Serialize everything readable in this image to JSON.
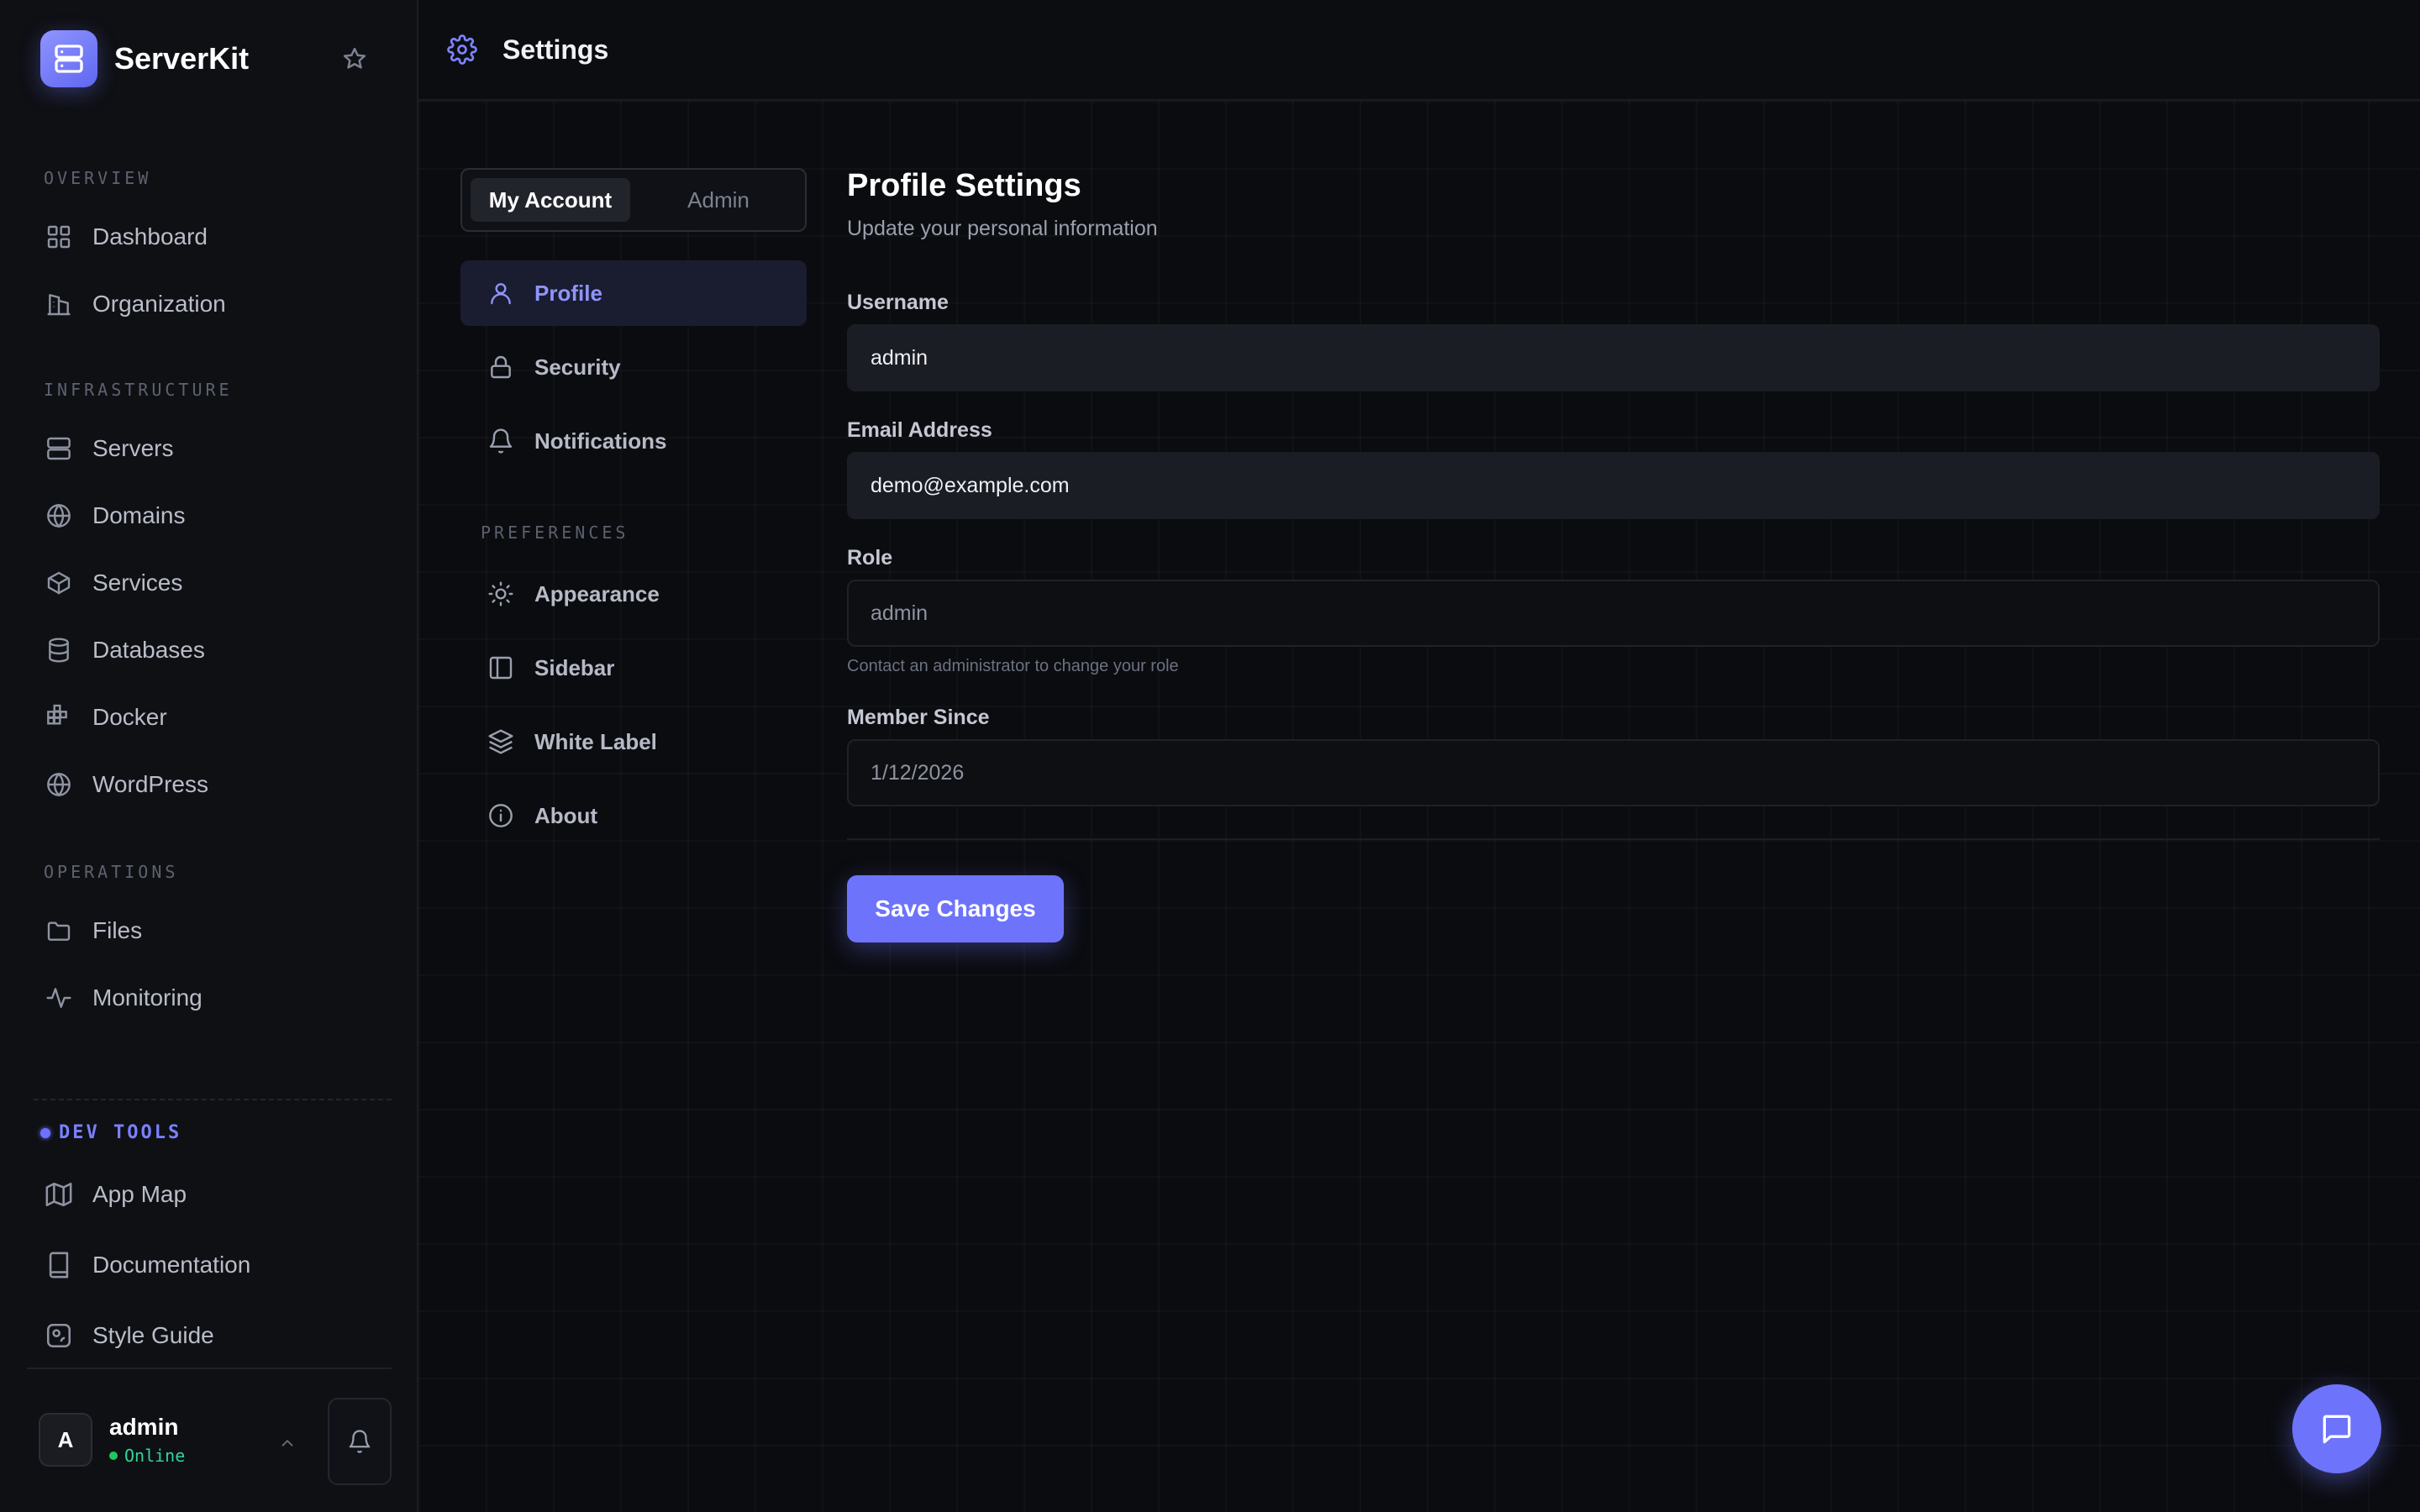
{
  "app": {
    "name": "ServerKit"
  },
  "sidebar": {
    "sections": {
      "overview": "OVERVIEW",
      "infrastructure": "INFRASTRUCTURE",
      "operations": "OPERATIONS"
    },
    "items": [
      {
        "label": "Dashboard",
        "icon": "grid-icon"
      },
      {
        "label": "Organization",
        "icon": "building-icon"
      },
      {
        "label": "Servers",
        "icon": "server-icon"
      },
      {
        "label": "Domains",
        "icon": "globe-icon"
      },
      {
        "label": "Services",
        "icon": "box-icon"
      },
      {
        "label": "Databases",
        "icon": "database-icon"
      },
      {
        "label": "Docker",
        "icon": "docker-icon"
      },
      {
        "label": "WordPress",
        "icon": "wordpress-icon"
      },
      {
        "label": "Files",
        "icon": "folder-icon"
      },
      {
        "label": "Monitoring",
        "icon": "activity-icon"
      }
    ],
    "devtools": {
      "label": "DEV TOOLS",
      "items": [
        {
          "label": "App Map",
          "icon": "map-icon"
        },
        {
          "label": "Documentation",
          "icon": "book-icon"
        },
        {
          "label": "Style Guide",
          "icon": "palette-icon"
        }
      ]
    },
    "user": {
      "initial": "A",
      "name": "admin",
      "status": "Online"
    }
  },
  "header": {
    "title": "Settings"
  },
  "settings_nav": {
    "tabs": [
      "My Account",
      "Admin"
    ],
    "active_tab": "My Account",
    "account_items": [
      {
        "label": "Profile",
        "icon": "user-icon",
        "active": true
      },
      {
        "label": "Security",
        "icon": "lock-icon"
      },
      {
        "label": "Notifications",
        "icon": "bell-icon"
      }
    ],
    "preferences_label": "PREFERENCES",
    "preference_items": [
      {
        "label": "Appearance",
        "icon": "sun-icon"
      },
      {
        "label": "Sidebar",
        "icon": "sidebar-icon"
      },
      {
        "label": "White Label",
        "icon": "layers-icon"
      },
      {
        "label": "About",
        "icon": "info-icon"
      }
    ]
  },
  "profile": {
    "title": "Profile Settings",
    "subtitle": "Update your personal information",
    "fields": {
      "username": {
        "label": "Username",
        "value": "admin"
      },
      "email": {
        "label": "Email Address",
        "value": "demo@example.com"
      },
      "role": {
        "label": "Role",
        "value": "admin",
        "hint": "Contact an administrator to change your role"
      },
      "member_since": {
        "label": "Member Since",
        "value": "1/12/2026"
      }
    },
    "save_label": "Save Changes"
  },
  "colors": {
    "accent": "#6d73fb",
    "background": "#0b0c10",
    "sidebar": "#0f1014",
    "online": "#22c55e"
  }
}
